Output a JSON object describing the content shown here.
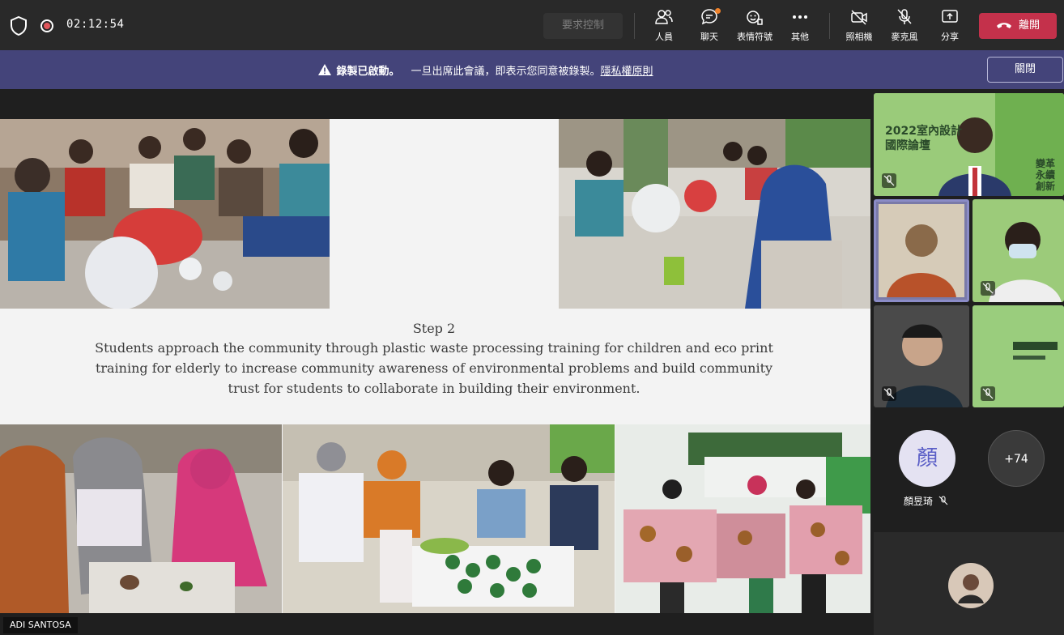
{
  "topbar": {
    "timer": "02:12:54",
    "request_control": "要求控制",
    "people": "人員",
    "chat": "聊天",
    "reactions": "表情符號",
    "more": "其他",
    "camera": "照相機",
    "mic": "麥克風",
    "share": "分享",
    "leave": "離開"
  },
  "banner": {
    "recording": "錄製已啟動。",
    "notice": "一旦出席此會議，即表示您同意被錄製。",
    "privacy_link": "隱私權原則",
    "close": "關閉"
  },
  "slide": {
    "step": "Step 2",
    "description": "Students approach the community through plastic waste processing training for children and eco print training for elderly to increase community awareness of environmental problems and build community trust for students to collaborate in building their environment."
  },
  "presenter_name": "ADI SANTOSA",
  "participants": {
    "conference_banner_title": "2022室內設計國際論壇",
    "conference_banner_tag": "變革永續創新",
    "avatar_initial": "顏",
    "avatar_name": "顏昱琦",
    "overflow_count": "+74"
  },
  "colors": {
    "leave_red": "#c4314b",
    "banner_purple": "#44447a",
    "active_speaker_border": "#8b8cc7"
  }
}
